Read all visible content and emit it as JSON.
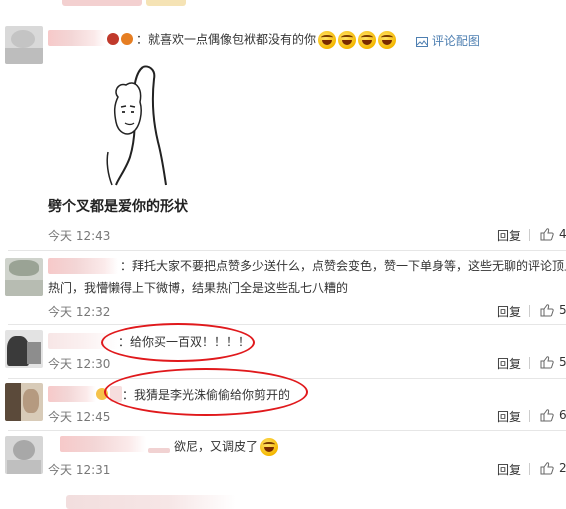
{
  "colors": {
    "accent_red": "#e0191c",
    "link_blue": "#4e7fb1",
    "divider": "#e6e6e6"
  },
  "comments": [
    {
      "text": "：就喜欢一点偶像包袱都没有的你",
      "report_label": "评论配图",
      "meme_caption": "劈个叉都是爱你的形状",
      "time": "今天 12:43",
      "reply_label": "回复",
      "like_count": "4"
    },
    {
      "text_line1": "：拜托大家不要把点赞多少送什么，点赞会变色，赞一下单身等，这些无聊的评论顶上",
      "text_line2": "热门，我懵懒得上下微博，结果热门全是这些乱七八糟的",
      "time": "今天 12:32",
      "reply_label": "回复",
      "like_count": "5"
    },
    {
      "text": "：给你买一百双！！！！",
      "time": "今天 12:30",
      "reply_label": "回复",
      "like_count": "5"
    },
    {
      "text": "：我猜是李光洙偷偷给你剪开的",
      "time": "今天 12:45",
      "reply_label": "回复",
      "like_count": "6"
    },
    {
      "text": "欲尼，又调皮了",
      "time": "今天 12:31",
      "reply_label": "回复",
      "like_count": "2"
    }
  ],
  "icons": {
    "like": "thumbs-up-icon",
    "laugh": "laughing-emoji-icon",
    "image": "image-icon",
    "vip": "vip-badge-icon"
  }
}
